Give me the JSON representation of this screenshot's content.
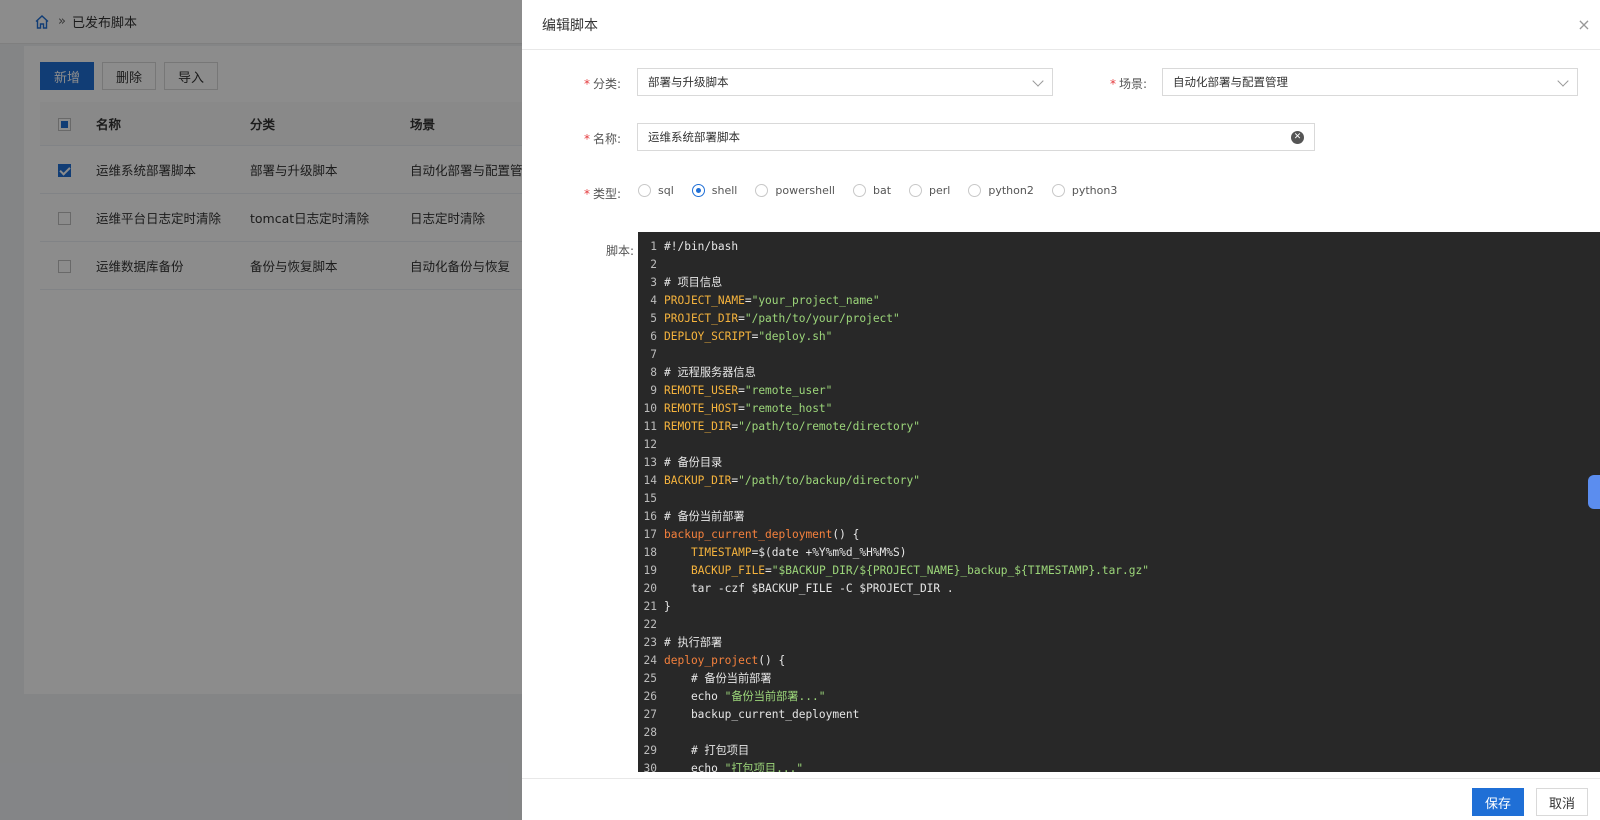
{
  "breadcrumb": {
    "current": "已发布脚本",
    "separator": "»"
  },
  "toolbar": {
    "add_label": "新增",
    "delete_label": "删除",
    "import_label": "导入"
  },
  "table": {
    "columns": [
      "名称",
      "分类",
      "场景"
    ],
    "rows": [
      {
        "name": "运维系统部署脚本",
        "category": "部署与升级脚本",
        "scene": "自动化部署与配置管理",
        "checked": true
      },
      {
        "name": "运维平台日志定时清除",
        "category": "tomcat日志定时清除",
        "scene": "日志定时清除",
        "checked": false
      },
      {
        "name": "运维数据库备份",
        "category": "备份与恢复脚本",
        "scene": "自动化备份与恢复",
        "checked": false
      }
    ]
  },
  "drawer": {
    "title": "编辑脚本",
    "category_label": "分类:",
    "category_value": "部署与升级脚本",
    "scene_label": "场景:",
    "scene_value": "自动化部署与配置管理",
    "name_label": "名称:",
    "name_value": "运维系统部署脚本",
    "type_label": "类型:",
    "types": [
      "sql",
      "shell",
      "powershell",
      "bat",
      "perl",
      "python2",
      "python3"
    ],
    "selected_type": "shell",
    "script_label": "脚本:",
    "required_mark": "*",
    "save_label": "保存",
    "cancel_label": "取消",
    "close_glyph": "×"
  },
  "script_lines": [
    "#!/bin/bash",
    "",
    "# 项目信息",
    "PROJECT_NAME=\"your_project_name\"",
    "PROJECT_DIR=\"/path/to/your/project\"",
    "DEPLOY_SCRIPT=\"deploy.sh\"",
    "",
    "# 远程服务器信息",
    "REMOTE_USER=\"remote_user\"",
    "REMOTE_HOST=\"remote_host\"",
    "REMOTE_DIR=\"/path/to/remote/directory\"",
    "",
    "# 备份目录",
    "BACKUP_DIR=\"/path/to/backup/directory\"",
    "",
    "# 备份当前部署",
    "backup_current_deployment() {",
    "    TIMESTAMP=$(date +%Y%m%d_%H%M%S)",
    "    BACKUP_FILE=\"$BACKUP_DIR/${PROJECT_NAME}_backup_${TIMESTAMP}.tar.gz\"",
    "    tar -czf $BACKUP_FILE -C $PROJECT_DIR .",
    "}",
    "",
    "# 执行部署",
    "deploy_project() {",
    "    # 备份当前部署",
    "    echo \"备份当前部署...\"",
    "    backup_current_deployment",
    "",
    "    # 打包项目",
    "    echo \"打包项目...\""
  ],
  "colors": {
    "primary": "#1f6fd6",
    "editor_bg": "#282828",
    "var": "#f5b33d",
    "string": "#9cd67a",
    "function": "#f5813d"
  }
}
